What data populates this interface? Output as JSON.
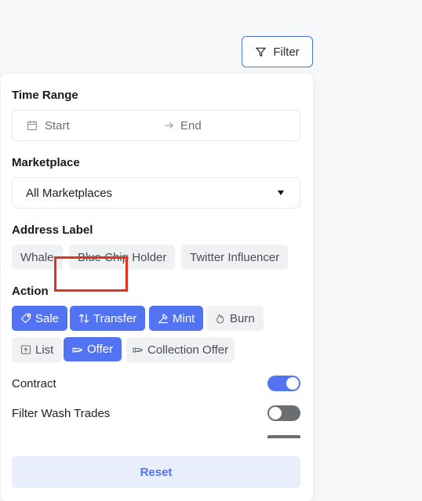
{
  "filter_button": {
    "label": "Filter",
    "icon": "funnel-icon"
  },
  "time_range": {
    "title": "Time Range",
    "start_placeholder": "Start",
    "end_placeholder": "End"
  },
  "marketplace": {
    "title": "Marketplace",
    "selected": "All Marketplaces"
  },
  "address_label": {
    "title": "Address Label",
    "options": [
      "Whale",
      "Blue Chip Holder",
      "Twitter Influencer"
    ]
  },
  "action": {
    "title": "Action",
    "options": [
      {
        "label": "Sale",
        "active": true,
        "icon": "tag-icon"
      },
      {
        "label": "Transfer",
        "active": true,
        "icon": "swap-icon"
      },
      {
        "label": "Mint",
        "active": true,
        "icon": "mint-icon"
      },
      {
        "label": "Burn",
        "active": false,
        "icon": "flame-icon"
      },
      {
        "label": "List",
        "active": false,
        "icon": "upload-box-icon"
      },
      {
        "label": "Offer",
        "active": true,
        "icon": "offer-hand-icon"
      },
      {
        "label": "Collection Offer",
        "active": false,
        "icon": "offer-hand-icon"
      }
    ]
  },
  "toggles": [
    {
      "label": "Contract",
      "on": true
    },
    {
      "label": "Filter Wash Trades",
      "on": false
    }
  ],
  "reset_label": "Reset",
  "colors": {
    "accent": "#5374f2",
    "highlight": "#e0321c",
    "chip_bg": "#f0f1f3",
    "reset_bg": "#e9eefc"
  }
}
